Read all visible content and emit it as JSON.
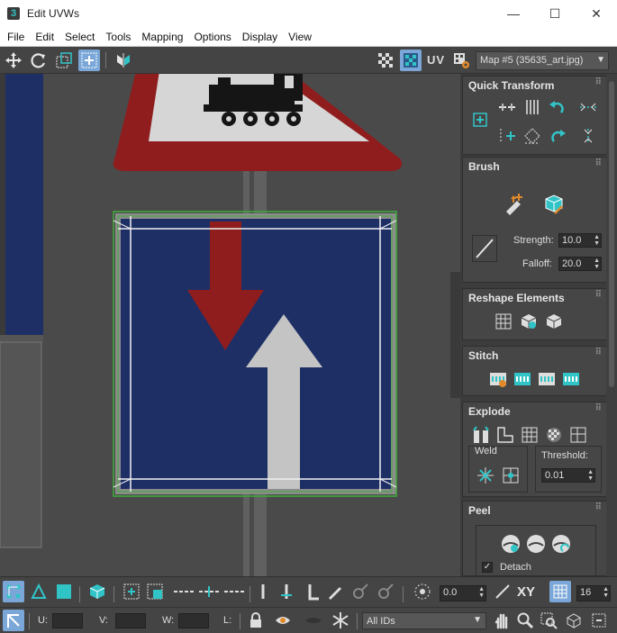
{
  "window": {
    "app_icon": "3",
    "title": "Edit UVWs",
    "minimize": "—",
    "maximize": "☐",
    "close": "✕"
  },
  "menu": [
    "File",
    "Edit",
    "Select",
    "Tools",
    "Mapping",
    "Options",
    "Display",
    "View"
  ],
  "toolbar": {
    "uv_label": "UV",
    "map_dropdown": "Map #5 (35635_art.jpg)"
  },
  "rollouts": {
    "quick_transform": {
      "title": "Quick Transform"
    },
    "brush": {
      "title": "Brush",
      "strength_label": "Strength:",
      "strength_value": "10.0",
      "falloff_label": "Falloff:",
      "falloff_value": "20.0"
    },
    "reshape": {
      "title": "Reshape Elements"
    },
    "stitch": {
      "title": "Stitch"
    },
    "explode": {
      "title": "Explode",
      "weld_label": "Weld",
      "threshold_label": "Threshold:",
      "threshold_value": "0.01"
    },
    "peel": {
      "title": "Peel",
      "detach_label": "Detach",
      "detach_checked": true
    }
  },
  "bottom": {
    "angle_value": "0.0",
    "xy_label": "XY",
    "grid_value": "16",
    "u_label": "U:",
    "v_label": "V:",
    "w_label": "W:",
    "l_label": "L:",
    "ids_dropdown": "All IDs"
  },
  "colors": {
    "accent": "#31c4c7",
    "active_button": "#7aa7d8",
    "sign_blue": "#1e2f66",
    "sign_red": "#8f1d1d",
    "selection_green": "#3fae3a"
  }
}
